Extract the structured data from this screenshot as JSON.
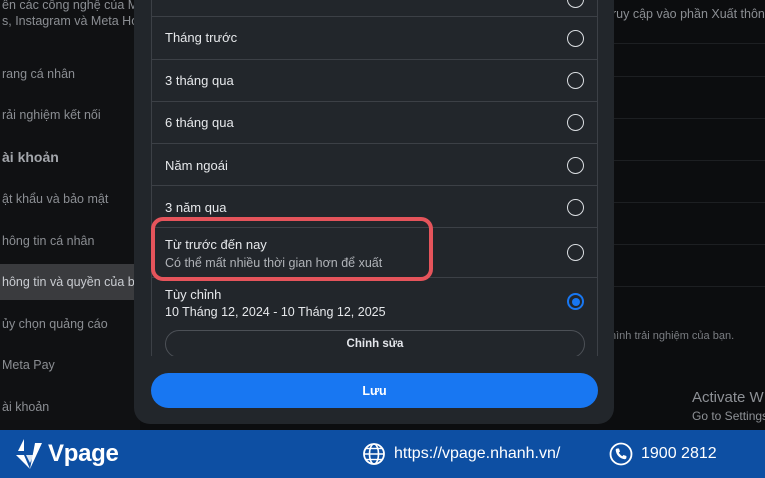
{
  "background": {
    "description": "ển các công nghệ của M\ns, Instagram và Meta Ho",
    "nav_items": [
      {
        "label": "rang cá nhân"
      },
      {
        "label": "rải nghiệm kết nối"
      },
      {
        "label": "ài khoản",
        "heading": true
      },
      {
        "label": "ật khẩu và bảo mật"
      },
      {
        "label": "hông tin cá nhân"
      },
      {
        "label": "hông tin và quyền của b"
      },
      {
        "label": "ủy chọn quảng cáo"
      },
      {
        "label": "Meta Pay"
      },
      {
        "label": "ài khoản"
      }
    ],
    "right_text": "ruy cập vào phần Xuất thôn",
    "right_text2": "hình trải nghiệm của bạn.",
    "watermark_line1": "Activate W",
    "watermark_line2": "Go to Settings"
  },
  "modal": {
    "options": [
      {
        "label": "Tháng trước",
        "selected": false
      },
      {
        "label": "3 tháng qua",
        "selected": false
      },
      {
        "label": "6 tháng qua",
        "selected": false
      },
      {
        "label": "Năm ngoái",
        "selected": false
      },
      {
        "label": "3 năm qua",
        "selected": false
      },
      {
        "label": "Từ trước đến nay",
        "sublabel": "Có thể mất nhiều thời gian hơn để xuất",
        "selected": false
      },
      {
        "label": "Tùy chỉnh",
        "sublabel": "10 Tháng 12, 2024 - 10 Tháng 12, 2025",
        "selected": true
      }
    ],
    "edit_label": "Chỉnh sửa",
    "save_label": "Lưu"
  },
  "footer": {
    "brand": "Vpage",
    "url": "https://vpage.nhanh.vn/",
    "phone": "1900 2812"
  },
  "colors": {
    "accent": "#1877f2",
    "highlight": "#e5545b",
    "banner": "#0d4fa3"
  }
}
